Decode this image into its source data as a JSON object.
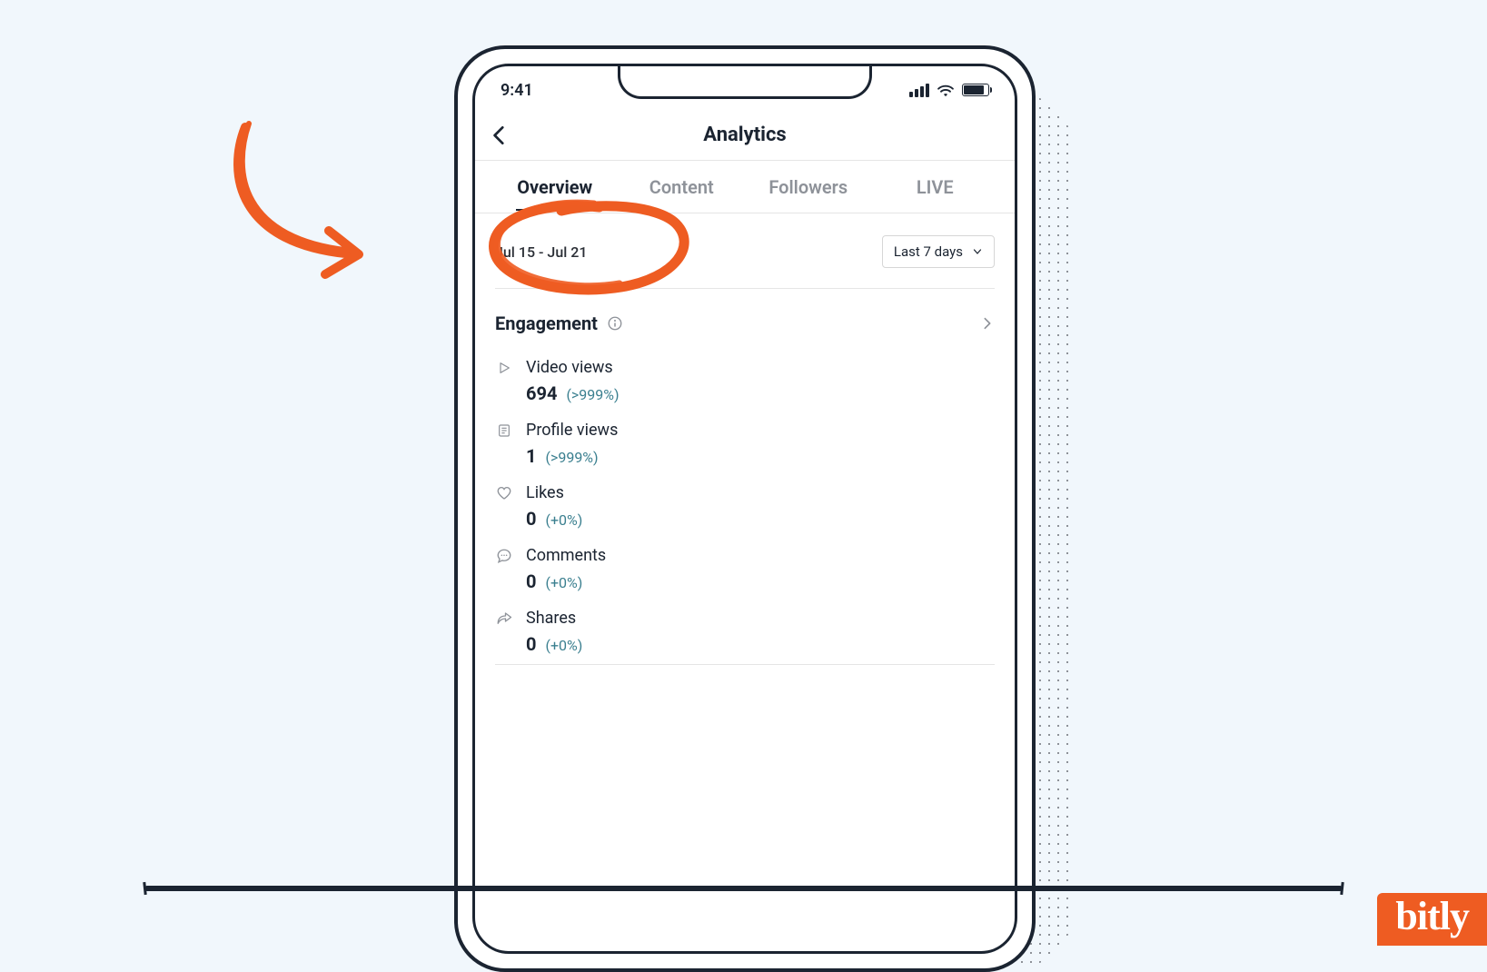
{
  "statusbar": {
    "time": "9:41"
  },
  "nav": {
    "title": "Analytics"
  },
  "tabs": [
    {
      "label": "Overview",
      "active": true
    },
    {
      "label": "Content",
      "active": false
    },
    {
      "label": "Followers",
      "active": false
    },
    {
      "label": "LIVE",
      "active": false
    }
  ],
  "period": {
    "range": "Jul 15 - Jul 21",
    "selector": "Last 7 days"
  },
  "section": {
    "title": "Engagement"
  },
  "metrics": [
    {
      "icon": "play",
      "label": "Video views",
      "value": "694",
      "delta": "(>999%)"
    },
    {
      "icon": "profile",
      "label": "Profile views",
      "value": "1",
      "delta": "(>999%)"
    },
    {
      "icon": "heart",
      "label": "Likes",
      "value": "0",
      "delta": "(+0%)"
    },
    {
      "icon": "comment",
      "label": "Comments",
      "value": "0",
      "delta": "(+0%)"
    },
    {
      "icon": "share",
      "label": "Shares",
      "value": "0",
      "delta": "(+0%)"
    }
  ],
  "brand": {
    "name": "bitly"
  }
}
